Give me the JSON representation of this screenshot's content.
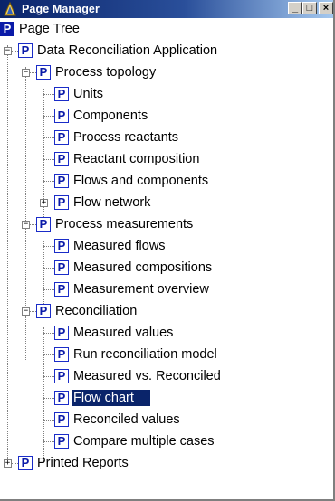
{
  "window": {
    "title": "Page Manager",
    "minimize_label": "_",
    "maximize_label": "□",
    "close_label": "×"
  },
  "tree": {
    "root_label": "Page Tree",
    "nodes": [
      {
        "label": "Data Reconciliation Application",
        "expander": "−"
      },
      {
        "label": "Process topology",
        "expander": "−"
      },
      {
        "label": "Units"
      },
      {
        "label": "Components"
      },
      {
        "label": "Process reactants"
      },
      {
        "label": "Reactant composition"
      },
      {
        "label": "Flows and components"
      },
      {
        "label": "Flow network",
        "expander": "+"
      },
      {
        "label": "Process measurements",
        "expander": "−"
      },
      {
        "label": "Measured flows"
      },
      {
        "label": "Measured compositions"
      },
      {
        "label": "Measurement overview"
      },
      {
        "label": "Reconciliation",
        "expander": "−"
      },
      {
        "label": "Measured values"
      },
      {
        "label": "Run reconciliation model"
      },
      {
        "label": "Measured vs. Reconciled"
      },
      {
        "label": "Flow chart",
        "selected": true
      },
      {
        "label": "Reconciled values"
      },
      {
        "label": "Compare multiple cases"
      },
      {
        "label": "Printed Reports",
        "expander": "+"
      }
    ],
    "node_icon_letter": "P"
  },
  "colors": {
    "selection": "#0a246a",
    "title_gradient_start": "#0a246a",
    "title_gradient_end": "#a6caf0",
    "page_icon": "#0a1aa8"
  },
  "icons": {
    "app": "page-manager-icon",
    "node": "page-p-icon"
  }
}
